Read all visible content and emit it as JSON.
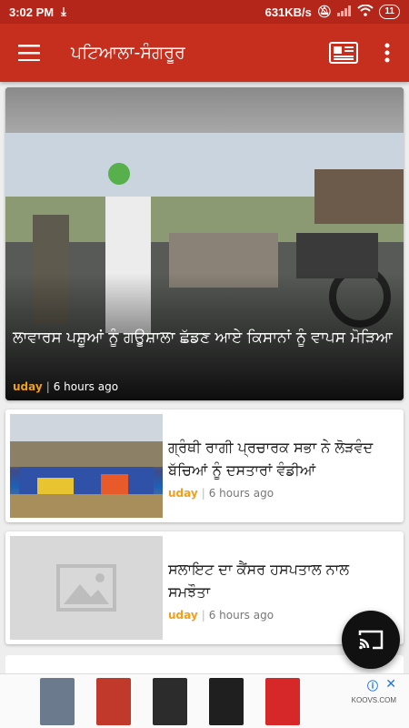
{
  "status_bar": {
    "time": "3:02 PM",
    "network_speed": "631KB/s",
    "battery": "11"
  },
  "app_bar": {
    "title": "ਪਟਿਆਲਾ-ਸੰਗਰੂਰ"
  },
  "hero": {
    "title": "ਲਾਵਾਰਸ ਪਸ਼ੂਆਂ ਨੂੰ ਗਊਸ਼ਾਲਾ ਛੱਡਣ ਆਏ ਕਿਸਾਨਾਂ ਨੂੰ ਵਾਪਸ ਮੋੜਿਆ",
    "author": "uday",
    "time": "6 hours ago"
  },
  "articles": [
    {
      "title": "ਗ੍ਰੰਥੀ ਰਾਗੀ ਪ੍ਰਚਾਰਕ ਸਭਾ ਨੇ ਲੋੜਵੰਦ ਬੱਚਿਆਂ ਨੂੰ ਦਸਤਾਰਾਂ ਵੰਡੀਆਂ",
      "author": "uday",
      "time": "6 hours ago"
    },
    {
      "title": "ਸਲਾਇਟ ਦਾ ਕੈਂਸਰ ਹਸਪਤਾਲ ਨਾਲ ਸਮਝੌਤਾ",
      "author": "uday",
      "time": "6 hours ago"
    }
  ],
  "ad": {
    "brand": "KOOVS.COM",
    "colors": [
      "#6b7a8c",
      "#c0392b",
      "#2c2c2c",
      "#1f1f1f",
      "#d62828"
    ]
  }
}
